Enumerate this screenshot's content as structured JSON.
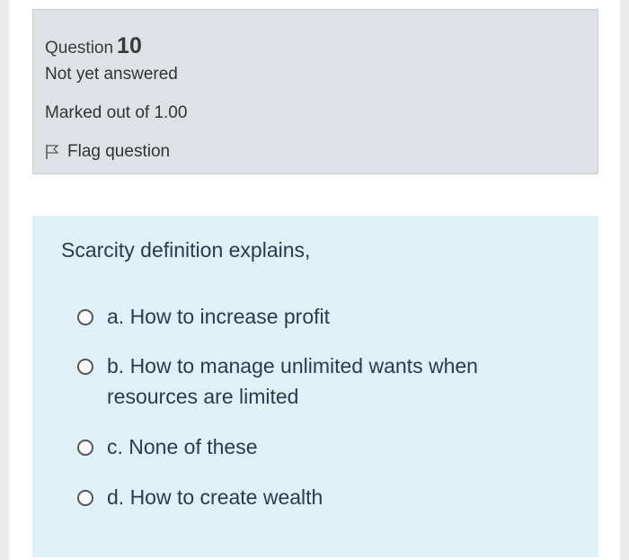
{
  "question": {
    "label": "Question",
    "number": "10",
    "state": "Not yet answered",
    "grade": "Marked out of 1.00",
    "flag_label": "Flag question",
    "flag_icon": "flag-icon"
  },
  "content": {
    "text": "Scarcity definition explains,",
    "answers": [
      {
        "text": "a. How to increase profit"
      },
      {
        "text": "b. How to manage unlimited wants when resources are limited"
      },
      {
        "text": "c. None of these"
      },
      {
        "text": "d. How to create wealth"
      }
    ]
  }
}
